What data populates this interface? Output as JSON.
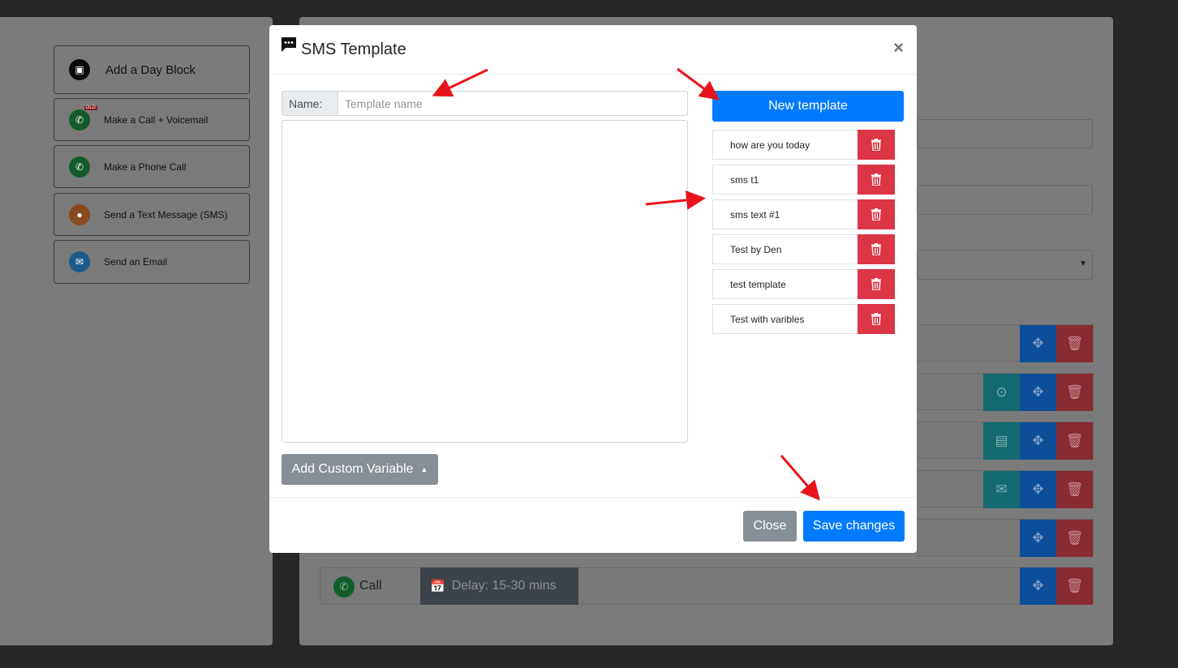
{
  "blocks": [
    {
      "label": "Add a Day Block",
      "icon": "calendar-icon",
      "color": "#0a0a0a"
    },
    {
      "label": "Make a Call + Voicemail",
      "icon": "phone-voicemail-icon",
      "color": "#135c2a",
      "badge": "OLD"
    },
    {
      "label": "Make a Phone Call",
      "icon": "phone-icon",
      "color": "#135c2a"
    },
    {
      "label": "Send a Text Message (SMS)",
      "icon": "sms-icon",
      "color": "#8a4a1f"
    },
    {
      "label": "Send an Email",
      "icon": "email-icon",
      "color": "#1c5a8a"
    }
  ],
  "sequence": {
    "call_label": "Call",
    "delay_label": "Delay: 15-30 mins"
  },
  "modal": {
    "title": "SMS Template",
    "close_symbol": "×",
    "name_label": "Name:",
    "name_placeholder": "Template name",
    "name_value": "",
    "body_value": "",
    "custom_variable_label": "Add Custom Variable",
    "new_template_label": "New template",
    "templates": [
      {
        "name": "how are you today"
      },
      {
        "name": "sms t1"
      },
      {
        "name": "sms text #1"
      },
      {
        "name": "Test by Den"
      },
      {
        "name": "test template"
      },
      {
        "name": "Test with varibles"
      }
    ],
    "close_label": "Close",
    "save_label": "Save changes"
  },
  "colors": {
    "primary": "#007bff",
    "danger": "#dc3545",
    "secondary": "#868e96",
    "annotation_arrow": "#e8141b"
  }
}
